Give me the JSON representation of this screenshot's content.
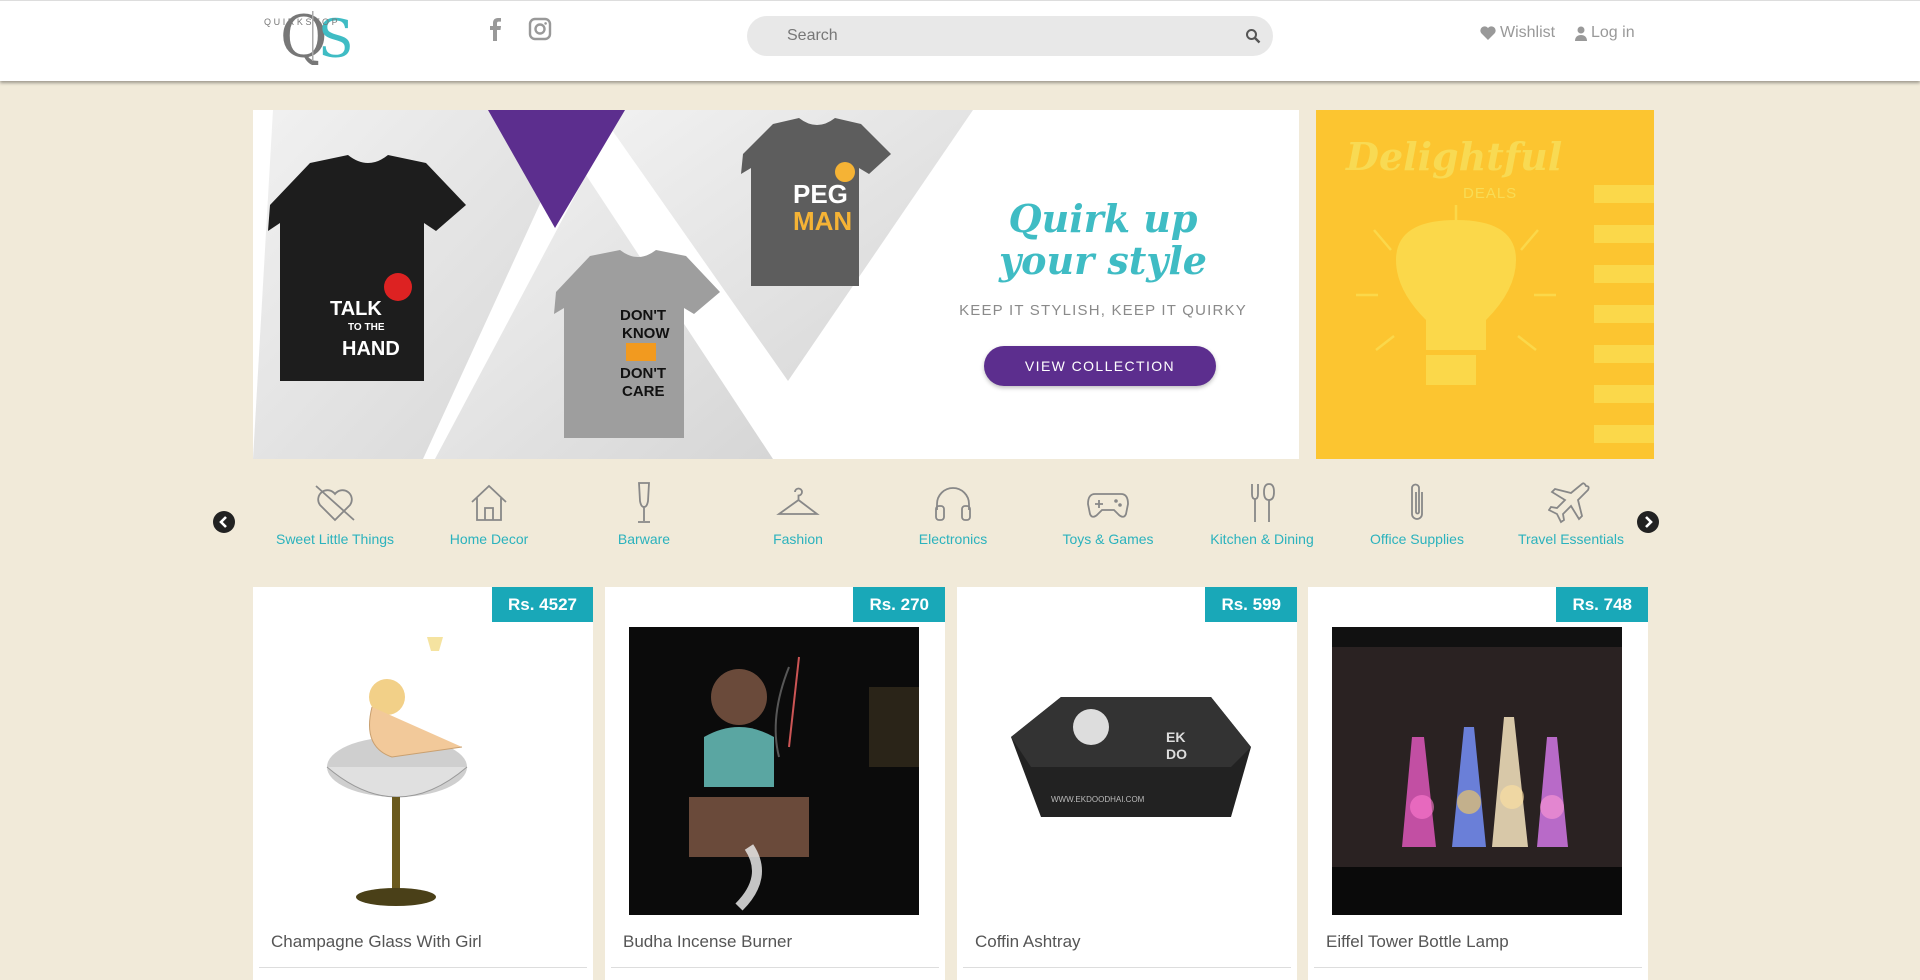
{
  "header": {
    "brand_top": "QUIRKSTOP",
    "brand_letters": "QS",
    "search_placeholder": "Search",
    "wishlist_label": "Wishlist",
    "login_label": "Log in"
  },
  "hero": {
    "headline_1": "Quirk up",
    "headline_2": "your style",
    "tagline": "KEEP IT STYLISH, KEEP IT QUIRKY",
    "button_label": "VIEW COLLECTION",
    "tshirt_1_text": "TALK TO THE HAND",
    "tshirt_2_text": "DON'T KNOW DON'T CARE",
    "tshirt_3_text": "PEG MAN"
  },
  "side_banner": {
    "title": "Delightful",
    "subtitle": "DEALS"
  },
  "categories": [
    {
      "label": "Sweet Little Things",
      "icon": "heart-arrow-icon"
    },
    {
      "label": "Home Decor",
      "icon": "home-icon"
    },
    {
      "label": "Barware",
      "icon": "champagne-glass-icon"
    },
    {
      "label": "Fashion",
      "icon": "hanger-icon"
    },
    {
      "label": "Electronics",
      "icon": "headphones-icon"
    },
    {
      "label": "Toys & Games",
      "icon": "gamepad-icon"
    },
    {
      "label": "Kitchen & Dining",
      "icon": "fork-spoon-icon"
    },
    {
      "label": "Office Supplies",
      "icon": "paperclip-icon"
    },
    {
      "label": "Travel Essentials",
      "icon": "airplane-icon"
    }
  ],
  "products": [
    {
      "price": "Rs. 4527",
      "name": "Champagne Glass With Girl"
    },
    {
      "price": "Rs. 270",
      "name": "Budha Incense Burner"
    },
    {
      "price": "Rs. 599",
      "name": "Coffin Ashtray"
    },
    {
      "price": "Rs. 748",
      "name": "Eiffel Tower Bottle Lamp"
    }
  ],
  "colors": {
    "page_bg": "#f1ead9",
    "accent_teal": "#19a8b8",
    "brand_purple": "#5c2e8e",
    "deals_yellow": "#fcc530"
  }
}
